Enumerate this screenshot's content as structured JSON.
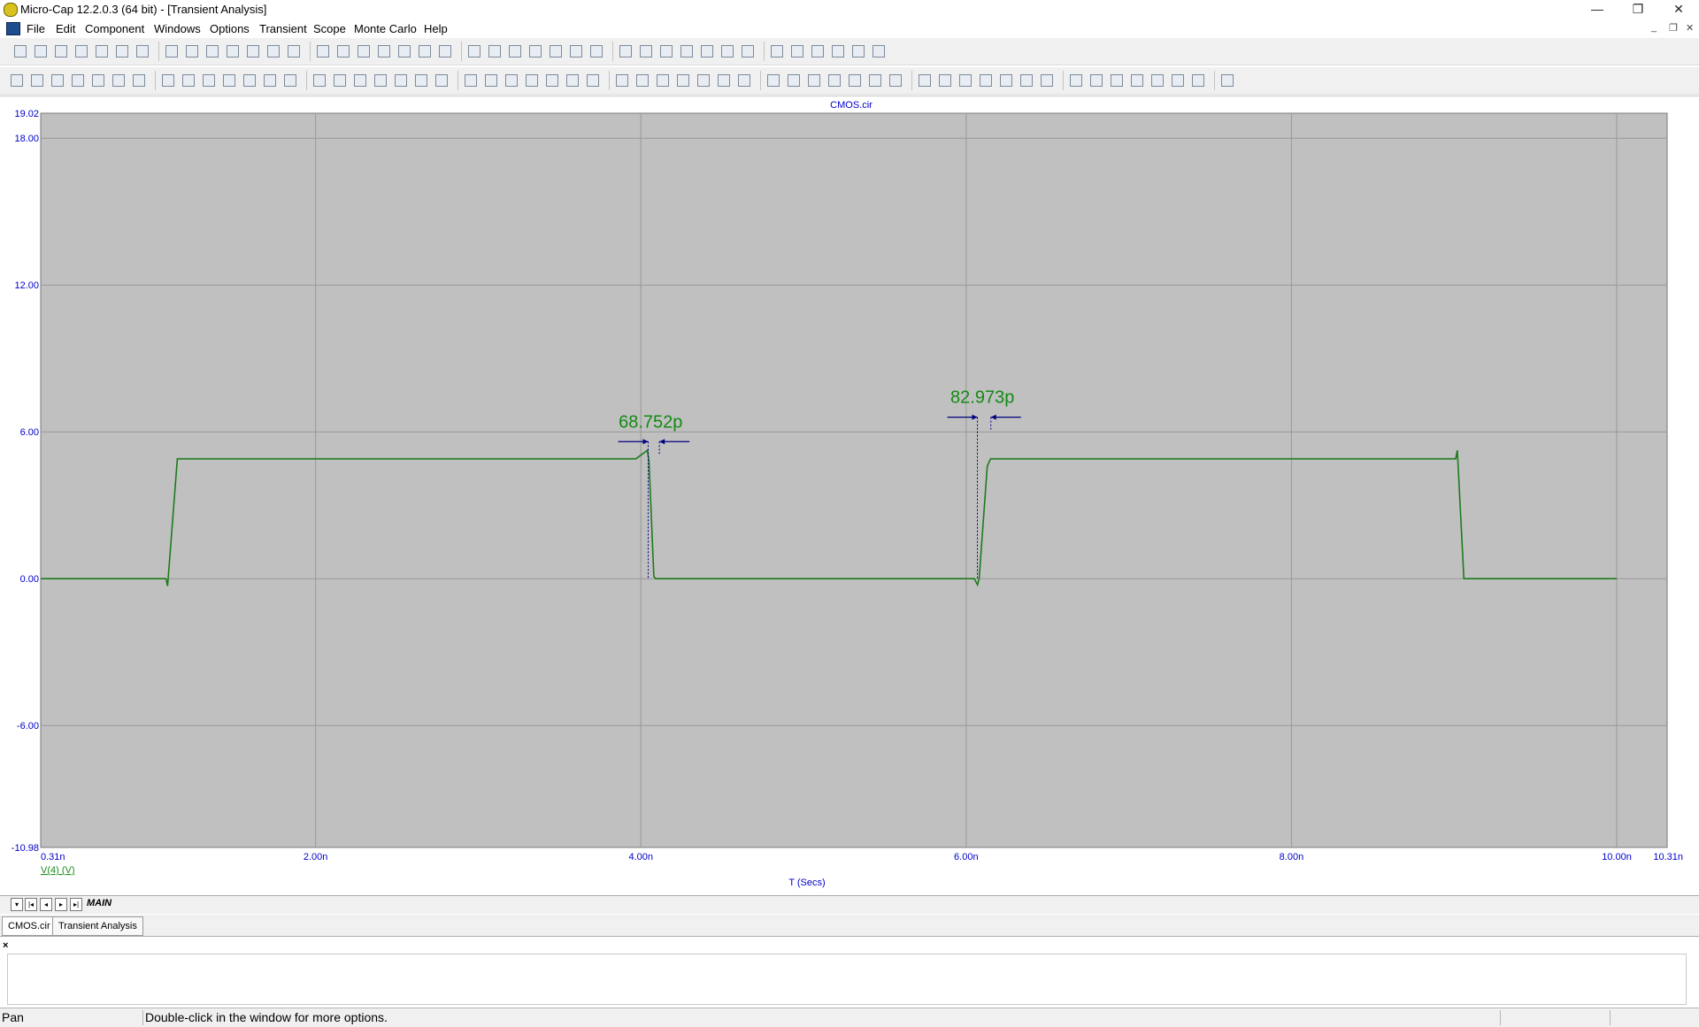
{
  "window": {
    "title": "Micro-Cap 12.2.0.3 (64 bit) - [Transient Analysis]",
    "minimize_glyph": "—",
    "restore_glyph": "❐",
    "close_glyph": "✕",
    "mdi_minimize_glyph": "_",
    "mdi_restore_glyph": "❐",
    "mdi_close_glyph": "✕"
  },
  "menu": [
    {
      "label": "File"
    },
    {
      "label": "Edit"
    },
    {
      "label": "Component"
    },
    {
      "label": "Windows"
    },
    {
      "label": "Options"
    },
    {
      "label": "Transient"
    },
    {
      "label": "Scope"
    },
    {
      "label": "Monte Carlo"
    },
    {
      "label": "Help"
    }
  ],
  "toolbar_icons": {
    "row1": [
      "new-file-icon",
      "open-file-icon",
      "save-icon",
      "save-all-icon",
      "print-preview-icon",
      "print-icon",
      "undo-icon",
      "redo-icon",
      "cut-icon",
      "copy-icon",
      "paste-icon",
      "delete-icon",
      "select-all-icon",
      "ground-icon",
      "resistor-icon",
      "capacitor-icon",
      "inductor-icon",
      "diode-icon",
      "battery-icon",
      "transistor-icon",
      "opamp-icon",
      "source-icon",
      "switch-icon",
      "junction-icon",
      "node-icon",
      "cascade-icon",
      "tile-vertical-icon",
      "tile-horizontal-icon",
      "window-icon",
      "window-layout-icon",
      "calculator-icon",
      "page-icon",
      "component-library-icon",
      "globe-icon",
      "probe-icon",
      "properties-icon",
      "info-icon",
      "help-icon",
      "tools-icon",
      "analysis-icon",
      "stepping-icon"
    ],
    "row2": [
      "pointer-icon",
      "pan-icon",
      "zoom-box-icon",
      "scale-icon",
      "auto-scale-icon",
      "fit-icon",
      "data-points-icon",
      "tokens-icon",
      "text-tool-icon",
      "graphics-icon",
      "run-icon",
      "stop-icon",
      "pause-icon",
      "cursor-mode-icon",
      "cursor-mode-2-icon",
      "box-icon",
      "grid-icon",
      "plot-icon",
      "plot-2-icon",
      "plot-3-icon",
      "plot-4-icon",
      "horizontal-tag-icon",
      "vertical-tag-icon",
      "zoom-in-icon",
      "zoom-out-icon",
      "zoom-fit-icon",
      "zoom-reset-icon",
      "properties-icon",
      "peak-icon",
      "valley-icon",
      "high-icon",
      "low-icon",
      "inflection-icon",
      "slope-icon",
      "global-high-icon",
      "global-low-icon",
      "top-icon",
      "bottom-icon",
      "tag-icon",
      "clipboard-icon",
      "ruler-icon",
      "report-icon",
      "dimension-icon",
      "dimension-2-icon",
      "magnify-icon",
      "shrink-icon",
      "color-icon",
      "font-icon",
      "font-color-icon",
      "layer-icon",
      "layer-2-icon",
      "align-left-icon",
      "align-center-icon",
      "align-right-icon",
      "align-top-icon",
      "align-middle-icon",
      "align-bottom-icon"
    ]
  },
  "colors": {
    "plot_bg": "#c0c0c0",
    "grid": "#989898",
    "trace": "#1d7a1d",
    "axis_text": "#0000cc",
    "trace_label": "#1d8c1d",
    "measure_label": "#138a13",
    "measure_arrow": "#000080"
  },
  "plot": {
    "file_title": "CMOS.cir",
    "x_axis_title": "T (Secs)",
    "y_tick_labels": [
      "19.02",
      "18.00",
      "12.00",
      "6.00",
      "0.00",
      "-6.00",
      "-10.98"
    ],
    "x_tick_labels": [
      "0.31n",
      "2.00n",
      "4.00n",
      "6.00n",
      "8.00n",
      "10.00n",
      "10.31n"
    ],
    "trace_label": "V(4) (V)",
    "measurements": [
      {
        "label": "68.752p",
        "x_ns": 4.06,
        "y": 5.6,
        "edge_from_ns": 4.045,
        "edge_to_ns": 4.114
      },
      {
        "label": "82.973p",
        "x_ns": 6.1,
        "y": 6.6,
        "edge_from_ns": 6.069,
        "edge_to_ns": 6.152
      }
    ]
  },
  "chart_data": {
    "type": "line",
    "title": "CMOS.cir",
    "xlabel": "T (Secs)",
    "ylabel": "",
    "xlim": [
      0.31,
      10.31
    ],
    "ylim": [
      -10.98,
      19.02
    ],
    "x_tick_values": [
      0.31,
      2.0,
      4.0,
      6.0,
      8.0,
      10.0,
      10.31
    ],
    "y_tick_values": [
      19.02,
      18.0,
      12.0,
      6.0,
      0.0,
      -6.0,
      -10.98
    ],
    "grid": true,
    "legend": "bottom-left",
    "series": [
      {
        "name": "V(4) (V)",
        "x": [
          0.31,
          1.08,
          1.09,
          1.15,
          3.97,
          4.04,
          4.05,
          4.08,
          4.09,
          6.05,
          6.07,
          6.08,
          6.13,
          6.15,
          9.01,
          9.02,
          9.06,
          10.0
        ],
        "y": [
          0.0,
          0.0,
          -0.3,
          4.9,
          4.9,
          5.25,
          4.8,
          0.1,
          0.0,
          0.0,
          -0.25,
          0.0,
          4.6,
          4.9,
          4.9,
          5.25,
          0.0,
          0.0
        ]
      }
    ]
  },
  "tabs": {
    "sheet_tab": "MAIN",
    "document_tabs": [
      {
        "label": "CMOS.cir"
      },
      {
        "label": "Transient Analysis"
      }
    ]
  },
  "output_pane": {
    "close_glyph": "×"
  },
  "status": {
    "mode": "Pan",
    "message": "Double-click in the window for more options."
  }
}
